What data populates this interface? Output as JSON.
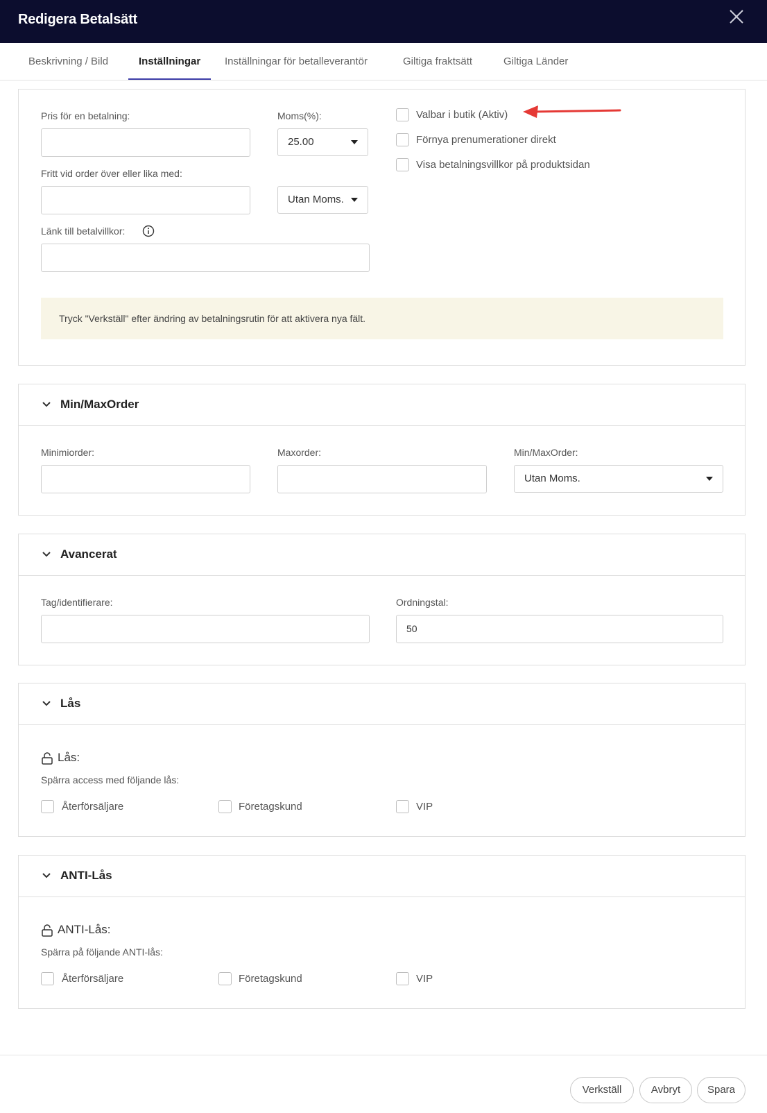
{
  "header": {
    "title": "Redigera Betalsätt"
  },
  "tabs": [
    {
      "label": "Beskrivning / Bild"
    },
    {
      "label": "Inställningar"
    },
    {
      "label": "Inställningar för betalleverantör"
    },
    {
      "label": "Giltiga fraktsätt"
    },
    {
      "label": "Giltiga Länder"
    }
  ],
  "settings": {
    "price_label": "Pris för en betalning:",
    "vat_label": "Moms(%):",
    "vat_value": "25.00",
    "free_label": "Fritt vid order över eller lika med:",
    "free_vat_value": "Utan Moms.",
    "terms_link_label": "Länk till betalvillkor:",
    "checkboxes": [
      {
        "label": "Valbar i butik (Aktiv)",
        "checked": false
      },
      {
        "label": "Förnya prenumerationer direkt",
        "checked": false
      },
      {
        "label": "Visa betalningsvillkor på produktsidan",
        "checked": false
      }
    ],
    "note": "Tryck \"Verkställ\" efter ändring av betalningsrutin för att aktivera nya fält."
  },
  "minmax": {
    "title": "Min/MaxOrder",
    "min_label": "Minimiorder:",
    "max_label": "Maxorder:",
    "vat_label": "Min/MaxOrder:",
    "vat_value": "Utan Moms."
  },
  "advanced": {
    "title": "Avancerat",
    "tag_label": "Tag/identifierare:",
    "order_label": "Ordningstal:",
    "order_value": "50"
  },
  "lock": {
    "title": "Lås",
    "subtitle": "Lås:",
    "desc": "Spärra access med följande lås:",
    "options": [
      "Återförsäljare",
      "Företagskund",
      "VIP"
    ]
  },
  "antilock": {
    "title": "ANTI-Lås",
    "subtitle": "ANTI-Lås:",
    "desc": "Spärra på följande ANTI-lås:",
    "options": [
      "Återförsäljare",
      "Företagskund",
      "VIP"
    ]
  },
  "footer": {
    "apply": "Verkställ",
    "cancel": "Avbryt",
    "save": "Spara"
  },
  "colors": {
    "header_bg": "#0c0d2e",
    "tab_active": "#3d3da8",
    "note_bg": "#f8f5e6",
    "arrow": "#e53935"
  }
}
